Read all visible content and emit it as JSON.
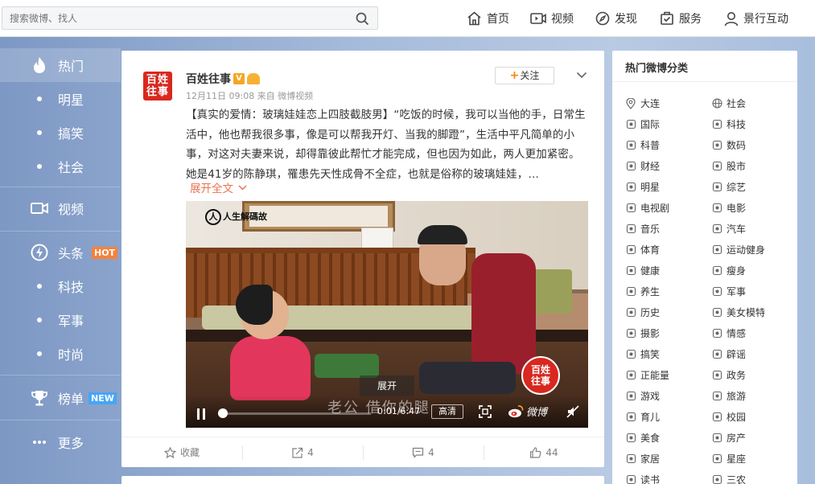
{
  "search": {
    "placeholder": "搜索微博、找人"
  },
  "topnav": [
    {
      "label": "首页",
      "icon": "home-icon"
    },
    {
      "label": "视频",
      "icon": "video-icon"
    },
    {
      "label": "发现",
      "icon": "compass-icon"
    },
    {
      "label": "服务",
      "icon": "service-icon"
    },
    {
      "label": "景行互动",
      "icon": "user-icon"
    }
  ],
  "leftnav": {
    "hot": "热门",
    "star": "明星",
    "funny": "搞笑",
    "society": "社会",
    "video": "视频",
    "headline": "头条",
    "headline_badge": "HOT",
    "tech": "科技",
    "military": "军事",
    "fashion": "时尚",
    "ranking": "榜单",
    "ranking_badge": "NEW",
    "more": "更多"
  },
  "post": {
    "avatar_text_1": "百姓",
    "avatar_text_2": "往事",
    "username": "百姓往事",
    "meta": "12月11日 09:08 来自 微博视频",
    "follow_label": "关注",
    "text": "【真实的爱情：玻璃娃娃恋上四肢截肢男】“吃饭的时候，我可以当他的手，日常生活中，他也帮我很多事，像是可以帮我开灯、当我的脚蹬”，生活中平凡简单的小事，对这对夫妻来说，却得靠彼此帮忙才能完成，但也因为如此，两人更加紧密。她是41岁的陈静琪，罹患先天性成骨不全症，也就是俗称的玻璃娃娃，…",
    "expand_label": "展开全文",
    "video": {
      "logo_text": "人生解碼故",
      "expand_label": "展开",
      "subtitle": "老公 借你的腿",
      "time": "0:01/6:47",
      "quality": "高清",
      "weibo_label": "微博",
      "watermark_1": "百姓",
      "watermark_2": "往事",
      "progress": 0.03
    },
    "actions": {
      "collect": "收藏",
      "repost": "4",
      "comment": "4",
      "like": "44"
    }
  },
  "rightpanel": {
    "title": "热门微博分类",
    "left": [
      {
        "label": "大连",
        "icon": "location-icon"
      },
      {
        "label": "国际",
        "icon": "globe-pin-icon"
      },
      {
        "label": "科普",
        "icon": "science-icon"
      },
      {
        "label": "财经",
        "icon": "finance-icon"
      },
      {
        "label": "明星",
        "icon": "star-icon"
      },
      {
        "label": "电视剧",
        "icon": "film-reel-icon"
      },
      {
        "label": "音乐",
        "icon": "music-icon"
      },
      {
        "label": "体育",
        "icon": "ball-icon"
      },
      {
        "label": "健康",
        "icon": "health-icon"
      },
      {
        "label": "养生",
        "icon": "teapot-icon"
      },
      {
        "label": "历史",
        "icon": "history-icon"
      },
      {
        "label": "摄影",
        "icon": "photo-icon"
      },
      {
        "label": "搞笑",
        "icon": "smile-icon"
      },
      {
        "label": "正能量",
        "icon": "sun-icon"
      },
      {
        "label": "游戏",
        "icon": "gamepad-icon"
      },
      {
        "label": "育儿",
        "icon": "baby-icon"
      },
      {
        "label": "美食",
        "icon": "food-icon"
      },
      {
        "label": "家居",
        "icon": "home-furniture-icon"
      },
      {
        "label": "读书",
        "icon": "book-icon"
      }
    ],
    "right": [
      {
        "label": "社会",
        "icon": "globe-icon"
      },
      {
        "label": "科技",
        "icon": "rocket-icon"
      },
      {
        "label": "数码",
        "icon": "device-icon"
      },
      {
        "label": "股市",
        "icon": "stock-icon"
      },
      {
        "label": "综艺",
        "icon": "variety-icon"
      },
      {
        "label": "电影",
        "icon": "movie-icon"
      },
      {
        "label": "汽车",
        "icon": "car-icon"
      },
      {
        "label": "运动健身",
        "icon": "fitness-icon"
      },
      {
        "label": "瘦身",
        "icon": "scale-icon"
      },
      {
        "label": "军事",
        "icon": "military-icon"
      },
      {
        "label": "美女模特",
        "icon": "model-icon"
      },
      {
        "label": "情感",
        "icon": "emotion-icon"
      },
      {
        "label": "辟谣",
        "icon": "rumor-icon"
      },
      {
        "label": "政务",
        "icon": "government-icon"
      },
      {
        "label": "旅游",
        "icon": "travel-icon"
      },
      {
        "label": "校园",
        "icon": "campus-icon"
      },
      {
        "label": "房产",
        "icon": "building-icon"
      },
      {
        "label": "星座",
        "icon": "zodiac-icon"
      },
      {
        "label": "三农",
        "icon": "agriculture-icon"
      }
    ]
  }
}
